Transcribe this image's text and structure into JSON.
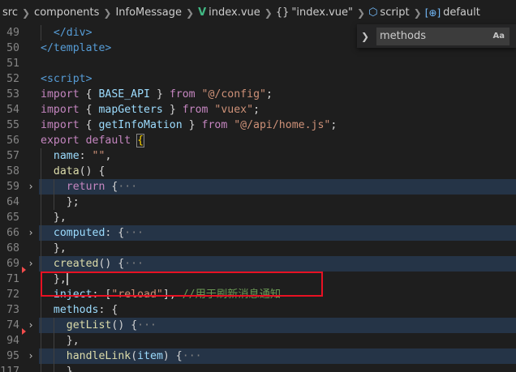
{
  "breadcrumb": {
    "items": [
      "src",
      "components",
      "InfoMessage",
      "index.vue",
      "\"index.vue\"",
      "script",
      "default"
    ],
    "icons": [
      "chevron-right-icon",
      "vue-file-icon",
      "braces-icon",
      "cube-icon",
      "field-icon"
    ]
  },
  "find_widget": {
    "value": "methods",
    "match_case_label": "Aa"
  },
  "editor": {
    "lines": [
      {
        "n": "49",
        "fold": "",
        "indent": 1,
        "tokens": [
          [
            "tag",
            "</div>"
          ]
        ],
        "highlight": false
      },
      {
        "n": "50",
        "fold": "",
        "indent": 0,
        "tokens": [
          [
            "tag",
            "</template>"
          ]
        ],
        "highlight": false
      },
      {
        "n": "51",
        "fold": "",
        "indent": 0,
        "tokens": [],
        "highlight": false
      },
      {
        "n": "52",
        "fold": "",
        "indent": 0,
        "tokens": [
          [
            "tag",
            "<script>"
          ]
        ],
        "highlight": false
      },
      {
        "n": "53",
        "fold": "",
        "indent": 0,
        "tokens": [
          [
            "ctl",
            "import"
          ],
          [
            "plain",
            " { "
          ],
          [
            "var",
            "BASE_API"
          ],
          [
            "plain",
            " } "
          ],
          [
            "ctl",
            "from"
          ],
          [
            "plain",
            " "
          ],
          [
            "str",
            "\"@/config\""
          ],
          [
            "plain",
            ";"
          ]
        ],
        "highlight": false
      },
      {
        "n": "54",
        "fold": "",
        "indent": 0,
        "tokens": [
          [
            "ctl",
            "import"
          ],
          [
            "plain",
            " { "
          ],
          [
            "var",
            "mapGetters"
          ],
          [
            "plain",
            " } "
          ],
          [
            "ctl",
            "from"
          ],
          [
            "plain",
            " "
          ],
          [
            "str",
            "\"vuex\""
          ],
          [
            "plain",
            ";"
          ]
        ],
        "highlight": false
      },
      {
        "n": "55",
        "fold": "",
        "indent": 0,
        "tokens": [
          [
            "ctl",
            "import"
          ],
          [
            "plain",
            " { "
          ],
          [
            "var",
            "getInfoMation"
          ],
          [
            "plain",
            " } "
          ],
          [
            "ctl",
            "from"
          ],
          [
            "plain",
            " "
          ],
          [
            "str",
            "\"@/api/home.js\""
          ],
          [
            "plain",
            ";"
          ]
        ],
        "highlight": false
      },
      {
        "n": "56",
        "fold": "",
        "indent": 0,
        "tokens": [
          [
            "ctl",
            "export"
          ],
          [
            "plain",
            " "
          ],
          [
            "ctl",
            "default"
          ],
          [
            "plain",
            " "
          ],
          [
            "bracket",
            "{"
          ]
        ],
        "highlight": false
      },
      {
        "n": "57",
        "fold": "",
        "indent": 1,
        "tokens": [
          [
            "var",
            "name"
          ],
          [
            "plain",
            ": "
          ],
          [
            "str",
            "\"\""
          ],
          [
            "plain",
            ","
          ]
        ],
        "highlight": false
      },
      {
        "n": "58",
        "fold": "",
        "indent": 1,
        "tokens": [
          [
            "fn",
            "data"
          ],
          [
            "plain",
            "() {"
          ]
        ],
        "highlight": false
      },
      {
        "n": "59",
        "fold": "›",
        "indent": 2,
        "tokens": [
          [
            "ctl",
            "return"
          ],
          [
            "plain",
            " {"
          ],
          [
            "punc",
            "···"
          ]
        ],
        "highlight": true
      },
      {
        "n": "64",
        "fold": "",
        "indent": 2,
        "tokens": [
          [
            "plain",
            "};"
          ]
        ],
        "highlight": false
      },
      {
        "n": "65",
        "fold": "",
        "indent": 1,
        "tokens": [
          [
            "plain",
            "},"
          ]
        ],
        "highlight": false
      },
      {
        "n": "66",
        "fold": "›",
        "indent": 1,
        "tokens": [
          [
            "var",
            "computed"
          ],
          [
            "plain",
            ": {"
          ],
          [
            "punc",
            "···"
          ]
        ],
        "highlight": true
      },
      {
        "n": "68",
        "fold": "",
        "indent": 1,
        "tokens": [
          [
            "plain",
            "},"
          ]
        ],
        "highlight": false
      },
      {
        "n": "69",
        "fold": "›",
        "indent": 1,
        "tokens": [
          [
            "fn",
            "created"
          ],
          [
            "plain",
            "() {"
          ],
          [
            "punc",
            "···"
          ]
        ],
        "highlight": true
      },
      {
        "n": "71",
        "fold": "",
        "indent": 1,
        "tokens": [
          [
            "plain",
            "},"
          ]
        ],
        "highlight": false
      },
      {
        "n": "72",
        "fold": "",
        "indent": 1,
        "tokens": [
          [
            "var",
            "inject"
          ],
          [
            "plain",
            ": ["
          ],
          [
            "str",
            "\"reload\""
          ],
          [
            "plain",
            "], "
          ],
          [
            "cmt",
            "//用于刷新消息通知"
          ]
        ],
        "highlight": false
      },
      {
        "n": "73",
        "fold": "",
        "indent": 1,
        "tokens": [
          [
            "var",
            "methods"
          ],
          [
            "plain",
            ": {"
          ]
        ],
        "highlight": false
      },
      {
        "n": "74",
        "fold": "›",
        "indent": 2,
        "tokens": [
          [
            "fn",
            "getList"
          ],
          [
            "plain",
            "() {"
          ],
          [
            "punc",
            "···"
          ]
        ],
        "highlight": true
      },
      {
        "n": "94",
        "fold": "",
        "indent": 2,
        "tokens": [
          [
            "plain",
            "},"
          ]
        ],
        "highlight": false
      },
      {
        "n": "95",
        "fold": "›",
        "indent": 2,
        "tokens": [
          [
            "fn",
            "handleLink"
          ],
          [
            "plain",
            "("
          ],
          [
            "var",
            "item"
          ],
          [
            "plain",
            ") {"
          ],
          [
            "punc",
            "···"
          ]
        ],
        "highlight": true
      },
      {
        "n": "117",
        "fold": "",
        "indent": 2,
        "tokens": [
          [
            "plain",
            "},"
          ]
        ],
        "highlight": false
      }
    ]
  },
  "colors": {
    "background": "#1e1e1e",
    "fold_highlight": "#253447",
    "annotation_box": "#e81123",
    "vue_green": "#41b883"
  }
}
